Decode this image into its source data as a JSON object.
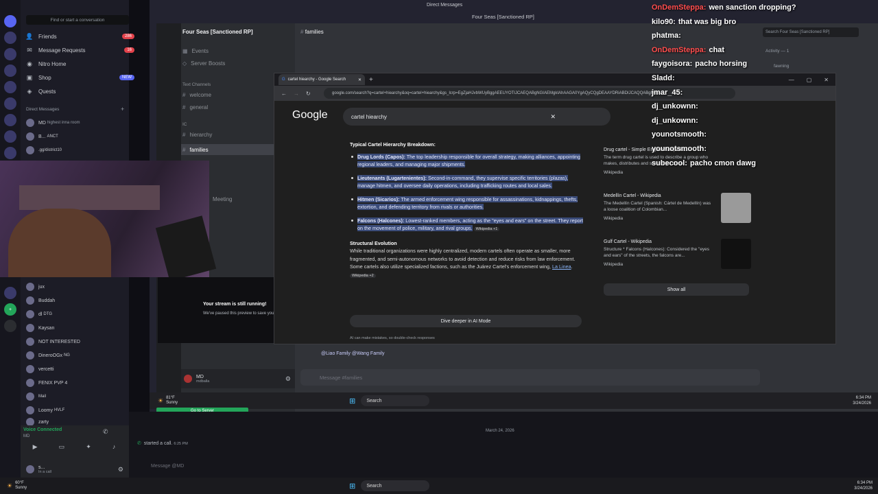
{
  "window": {
    "title": "Direct Messages",
    "inner_title": "Four Seas [Sanctioned RP]"
  },
  "sidebar": {
    "search_placeholder": "Find or start a conversation",
    "items": [
      {
        "label": "Friends",
        "badge": "286",
        "icon": "friends-icon"
      },
      {
        "label": "Message Requests",
        "badge": "16",
        "icon": "inbox-icon"
      },
      {
        "label": "Nitro Home",
        "badge": "",
        "icon": "nitro-icon"
      },
      {
        "label": "Shop",
        "badge": "NEW",
        "icon": "shop-icon"
      },
      {
        "label": "Quests",
        "badge": "",
        "icon": "quests-icon"
      }
    ],
    "dm_header": "Direct Messages",
    "dms": [
      {
        "name": "MD",
        "sub": "highest inna room",
        "tag": "SS4L"
      },
      {
        "name": "B...",
        "sub": "",
        "tag": "ANCT"
      },
      {
        "name": "",
        "sub": ".gg/district10",
        "tag": "25th"
      }
    ],
    "members": [
      {
        "name": "jux"
      },
      {
        "name": "Buddah"
      },
      {
        "name": "dl",
        "tag": "DTG"
      },
      {
        "name": "Kaysan"
      },
      {
        "name": "NOT INTERESTED"
      },
      {
        "name": "DineroOGx",
        "sub": ".gg/NeroSpot",
        "tag": "NG"
      },
      {
        "name": "vercetti"
      },
      {
        "name": "FENIX PVP 4"
      },
      {
        "name": "",
        "tag": "Mail"
      },
      {
        "name": "Loomy",
        "sub": "twitch.tv/loomyiq",
        "tag": "HVLF"
      },
      {
        "name": "zarty",
        "tag": "$$$"
      }
    ],
    "voice": {
      "status": "Voice Connected",
      "sub": "MD"
    },
    "user": {
      "name": "s...",
      "sub": "In a call"
    }
  },
  "server": {
    "name": "Four Seas [Sanctioned RP]",
    "channel": "families",
    "events": "Events",
    "boosts": "Server Boosts",
    "category": "Text Channels",
    "channels": [
      "welcome",
      "general",
      "hierarchy",
      "families"
    ],
    "ic": "IC",
    "meeting": "Meeting",
    "user": {
      "name": "MD",
      "sub": "mdballa"
    },
    "message_placeholder": "Message #families",
    "mentions": "@Liao Family @Wang Family",
    "weather": {
      "temp": "81°F",
      "cond": "Sunny"
    },
    "go_to_server": "Go to Server",
    "preview_title": "Your stream is still running!",
    "preview_sub": "We've paused this preview to save your re"
  },
  "browser": {
    "tab_title": "cartel hiearchy - Google Search",
    "url": "google.com/search?q=cartel+hiearchy&oq=cartel+hiearchy&gs_lcrp=EgZjaHJvbWUyBggAEEUYOTIJCAEQABgNGIAEMgkIAhAAGA0YgAQyCQgDEAAYDRiABDIJCAQQABgNGIAE",
    "logo": "Google",
    "query": "cartel hiearchy",
    "ai": {
      "heading": "Typical Cartel Hierarchy Breakdown:",
      "items": [
        {
          "b": "Drug Lords (Capos):",
          "t": " The top leadership responsible for overall strategy, making alliances, appointing regional leaders, and managing major shipments."
        },
        {
          "b": "Lieutenants (Lugartenientes):",
          "t": " Second-in-command, they supervise specific territories (plazas), manage hitmen, and oversee daily operations, including trafficking routes and local sales."
        },
        {
          "b": "Hitmen (Sicarios):",
          "t": " The armed enforcement wing responsible for assassinations, kidnappings, thefts, extortion, and defending territory from rivals or authorities."
        },
        {
          "b": "Falcons (Halcones):",
          "t": " Lowest-ranked members, acting as the \"eyes and ears\" on the street. They report on the movement of police, military, and rival groups.",
          "src": "Wikipedia +1"
        }
      ],
      "sub_heading": "Structural Evolution",
      "paragraph": "While traditional organizations were highly centralized, modern cartels often operate as smaller, more fragmented, and semi-autonomous networks to avoid detection and reduce risks from law enforcement. Some cartels also utilize specialized factions, such as the Juárez Cartel's enforcement wing,",
      "link": "La Linea",
      "link_src": "Wikipedia +2",
      "dive": "Dive deeper in AI Mode",
      "disclaimer": "AI can make mistakes, so double-check responses"
    },
    "cards": [
      {
        "title": "Drug cartel - Simple English Wikipedia...",
        "desc": "The term drug cartel is used to describe a group who makes, distributes and sells illegal drugs...",
        "src": "Wikipedia"
      },
      {
        "title": "Medellín Cartel - Wikipedia",
        "desc": "The Medellín Cartel (Spanish: Cártel de Medellín) was a loose coalition of Colombian...",
        "src": "Wikipedia"
      },
      {
        "title": "Gulf Cartel - Wikipedia",
        "desc": "Structure * Falcons (Halcones): Considered the \"eyes and ears\" of the streets, the falcons are...",
        "src": "Wikipedia"
      }
    ],
    "show_all": "Show all"
  },
  "chat_overlay": [
    {
      "user": "OnDemSteppa:",
      "msg": "wen sanction dropping?",
      "color": "#ff4d4d"
    },
    {
      "user": "kilo90:",
      "msg": "that was big bro",
      "color": "#ffffff"
    },
    {
      "user": "phatma:",
      "msg": "",
      "color": "#ffffff"
    },
    {
      "user": "OnDemSteppa:",
      "msg": "chat",
      "color": "#ff4d4d"
    },
    {
      "user": "faygoisora:",
      "msg": "pacho horsing",
      "color": "#ffffff"
    },
    {
      "user": "Sladd:",
      "msg": "",
      "color": "#ffffff"
    },
    {
      "user": "jmar_45:",
      "msg": "",
      "color": "#ffffff"
    },
    {
      "user": "dj_unkownn:",
      "msg": "",
      "color": "#ffffff"
    },
    {
      "user": "dj_unkownn:",
      "msg": "",
      "color": "#ffffff"
    },
    {
      "user": "younotsmooth:",
      "msg": "",
      "color": "#ffffff"
    },
    {
      "user": "younotsmooth:",
      "msg": "",
      "color": "#ffffff"
    },
    {
      "user": "subecool:",
      "msg": "pacho cmon dawg",
      "color": "#ffffff"
    }
  ],
  "right_panel": {
    "search": "Search Four Seas [Sanctioned RP]",
    "activity": "Activity — 1",
    "user": "fawning"
  },
  "footer": {
    "call": "started a call.",
    "call_time": "6:25 PM",
    "date": "March 24, 2026",
    "placeholder": "Message @MD"
  },
  "taskbar": {
    "search": "Search",
    "time": "6:34 PM",
    "date": "3/24/2026",
    "weather_temp": "60°F",
    "weather_cond": "Sunny"
  }
}
